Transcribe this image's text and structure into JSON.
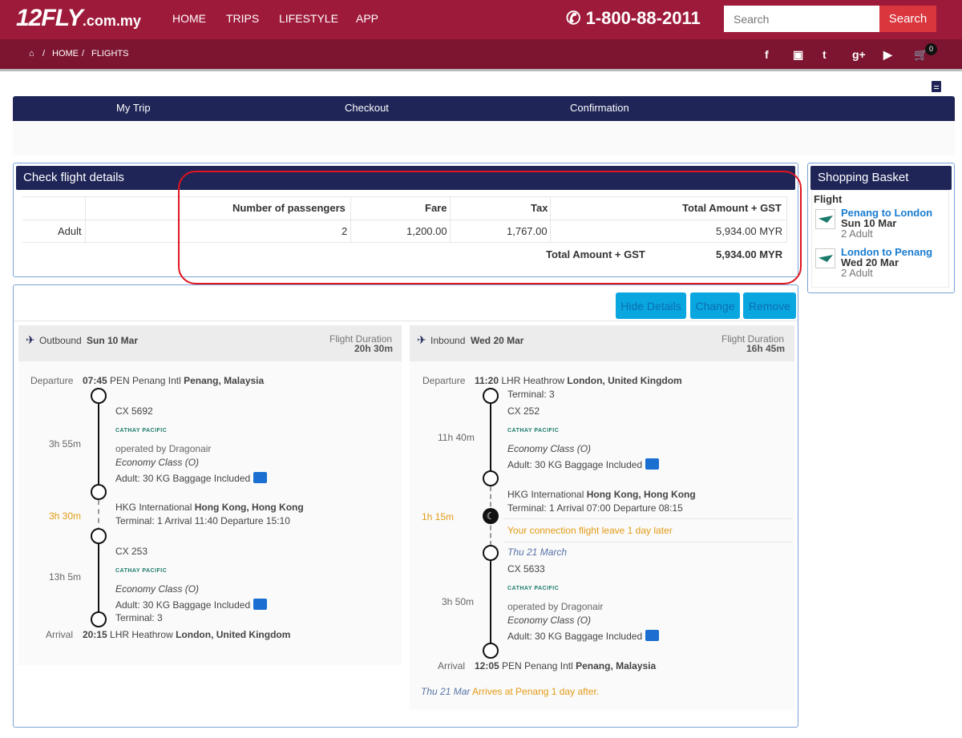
{
  "header": {
    "logo_main": "12FLY",
    "logo_suffix": ".com.my",
    "nav": [
      "HOME",
      "TRIPS",
      "LIFESTYLE",
      "APP"
    ],
    "phone": "1-800-88-2011",
    "search_placeholder": "Search",
    "search_button": "Search"
  },
  "breadcrumb": {
    "home": "HOME",
    "current": "FLIGHTS"
  },
  "cart": {
    "count": "0"
  },
  "steps": [
    "My Trip",
    "Checkout",
    "Confirmation"
  ],
  "check": {
    "title": "Check flight details",
    "headers": {
      "passengers": "Number of passengers",
      "fare": "Fare",
      "tax": "Tax",
      "total": "Total Amount + GST"
    },
    "row": {
      "type": "Adult",
      "passengers": "2",
      "fare": "1,200.00",
      "tax": "1,767.00",
      "total": "5,934.00 MYR"
    },
    "summary_label": "Total Amount + GST",
    "summary_value": "5,934.00 MYR"
  },
  "basket": {
    "title": "Shopping Basket",
    "section": "Flight",
    "items": [
      {
        "route": "Penang to London",
        "date": "Sun 10 Mar",
        "pax": "2 Adult"
      },
      {
        "route": "London to Penang",
        "date": "Wed 20 Mar",
        "pax": "2 Adult"
      }
    ]
  },
  "actions": {
    "hide": "Hide Details",
    "change": "Change",
    "remove": "Remove"
  },
  "outbound": {
    "label": "Outbound",
    "date": "Sun 10 Mar",
    "duration_label": "Flight Duration",
    "duration": "20h 30m",
    "dep_label": "Departure",
    "dep_time": "07:45",
    "dep_code": "PEN Penang Intl",
    "dep_city": "Penang, Malaysia",
    "leg1": {
      "flight": "CX 5692",
      "airline": "CATHAY PACIFIC",
      "operated": "operated by Dragonair",
      "class": "Economy Class (O)",
      "baggage": "Adult: 30 KG Baggage Included",
      "dur": "3h 55m"
    },
    "layover": {
      "dur": "3h 30m",
      "airport": "HKG International",
      "city": "Hong Kong, Hong Kong",
      "info": "Terminal: 1  Arrival 11:40 Departure 15:10"
    },
    "leg2": {
      "flight": "CX 253",
      "airline": "CATHAY PACIFIC",
      "class": "Economy Class (O)",
      "baggage": "Adult: 30 KG Baggage Included",
      "terminal": "Terminal: 3",
      "dur": "13h 5m"
    },
    "arr_label": "Arrival",
    "arr_time": "20:15",
    "arr_code": "LHR Heathrow",
    "arr_city": "London, United Kingdom"
  },
  "inbound": {
    "label": "Inbound",
    "date": "Wed 20 Mar",
    "duration_label": "Flight Duration",
    "duration": "16h 45m",
    "dep_label": "Departure",
    "dep_time": "11:20",
    "dep_code": "LHR Heathrow",
    "dep_city": "London, United Kingdom",
    "leg1": {
      "terminal": "Terminal: 3",
      "flight": "CX 252",
      "airline": "CATHAY PACIFIC",
      "class": "Economy Class (O)",
      "baggage": "Adult: 30 KG Baggage Included",
      "dur": "11h 40m"
    },
    "layover": {
      "dur": "1h 15m",
      "airport": "HKG International",
      "city": "Hong Kong, Hong Kong",
      "info": "Terminal: 1  Arrival 07:00 Departure 08:15",
      "warning": "Your connection flight leave 1 day later",
      "next_date": "Thu 21 March"
    },
    "leg2": {
      "flight": "CX 5633",
      "airline": "CATHAY PACIFIC",
      "operated": "operated by Dragonair",
      "class": "Economy Class (O)",
      "baggage": "Adult: 30 KG Baggage Included",
      "dur": "3h 50m"
    },
    "arr_label": "Arrival",
    "arr_time": "12:05",
    "arr_code": "PEN Penang Intl",
    "arr_city": "Penang, Malaysia",
    "arrive_date": "Thu 21 Mar",
    "arrive_note": "Arrives at Penang 1 day after."
  }
}
